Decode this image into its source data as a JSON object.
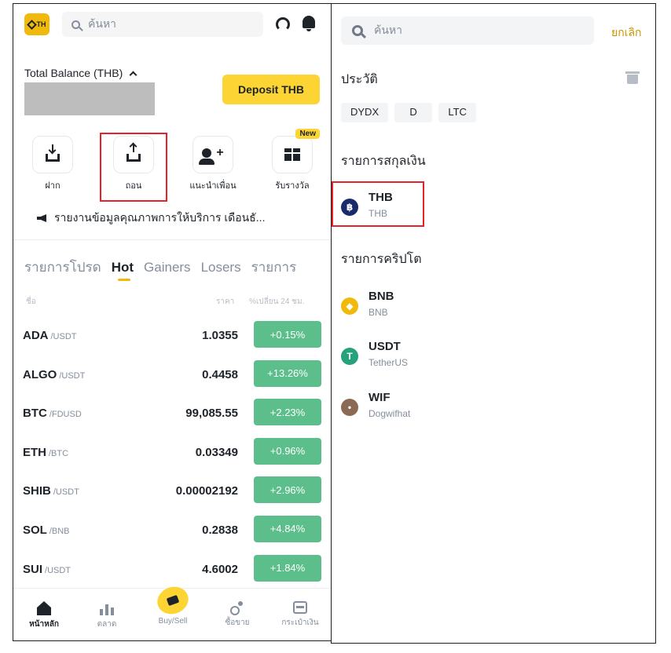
{
  "left": {
    "logo_text": "TH",
    "search_placeholder": "ค้นหา",
    "balance_label": "Total Balance (THB)",
    "deposit_button": "Deposit THB",
    "actions": [
      {
        "label": "ฝาก",
        "icon": "deposit-icon"
      },
      {
        "label": "ถอน",
        "icon": "withdraw-icon"
      },
      {
        "label": "แนะนำเพื่อน",
        "icon": "referral-icon"
      },
      {
        "label": "รับรางวัล",
        "icon": "gift-icon",
        "badge": "New"
      }
    ],
    "announcement": "รายงานข้อมูลคุณภาพการให้บริการ เดือนธั...",
    "tabs": [
      "รายการโปรด",
      "Hot",
      "Gainers",
      "Losers",
      "รายการ"
    ],
    "active_tab": "Hot",
    "columns": {
      "name": "ชื่อ",
      "price": "ราคา",
      "change": "%เปลี่ยน 24 ชม."
    },
    "markets": [
      {
        "base": "ADA",
        "quote": "/USDT",
        "price": "1.0355",
        "change": "+0.15%"
      },
      {
        "base": "ALGO",
        "quote": "/USDT",
        "price": "0.4458",
        "change": "+13.26%"
      },
      {
        "base": "BTC",
        "quote": "/FDUSD",
        "price": "99,085.55",
        "change": "+2.23%"
      },
      {
        "base": "ETH",
        "quote": "/BTC",
        "price": "0.03349",
        "change": "+0.96%"
      },
      {
        "base": "SHIB",
        "quote": "/USDT",
        "price": "0.00002192",
        "change": "+2.96%"
      },
      {
        "base": "SOL",
        "quote": "/BNB",
        "price": "0.2838",
        "change": "+4.84%"
      },
      {
        "base": "SUI",
        "quote": "/USDT",
        "price": "4.6002",
        "change": "+1.84%"
      }
    ],
    "nav": [
      {
        "label": "หน้าหลัก",
        "icon": "home-icon",
        "active": true
      },
      {
        "label": "ตลาด",
        "icon": "markets-icon",
        "active": false
      },
      {
        "label": "Buy/Sell",
        "icon": "buy-sell-icon",
        "active": false
      },
      {
        "label": "ซื้อขาย",
        "icon": "trade-icon",
        "active": false
      },
      {
        "label": "กระเป๋าเงิน",
        "icon": "wallet-icon",
        "active": false
      }
    ]
  },
  "right": {
    "search_placeholder": "ค้นหา",
    "cancel": "ยกเลิก",
    "history_title": "ประวัติ",
    "history": [
      "DYDX",
      "D",
      "LTC"
    ],
    "fiat_title": "รายการสกุลเงิน",
    "fiat": [
      {
        "symbol": "THB",
        "name": "THB",
        "icon": "thb-icon",
        "color": "#1a2b6b",
        "glyph": "฿"
      }
    ],
    "crypto_title": "รายการคริปโต",
    "crypto": [
      {
        "symbol": "BNB",
        "name": "BNB",
        "icon": "bnb-icon",
        "color": "#f0b90b",
        "glyph": "◆"
      },
      {
        "symbol": "USDT",
        "name": "TetherUS",
        "icon": "usdt-icon",
        "color": "#26a17b",
        "glyph": "T"
      },
      {
        "symbol": "WIF",
        "name": "Dogwifhat",
        "icon": "wif-icon",
        "color": "#8a6a55",
        "glyph": "•"
      }
    ]
  },
  "colors": {
    "accent": "#fcd535",
    "positive": "#5cbf8b",
    "highlight": "#e8202a",
    "link": "#c99400"
  }
}
